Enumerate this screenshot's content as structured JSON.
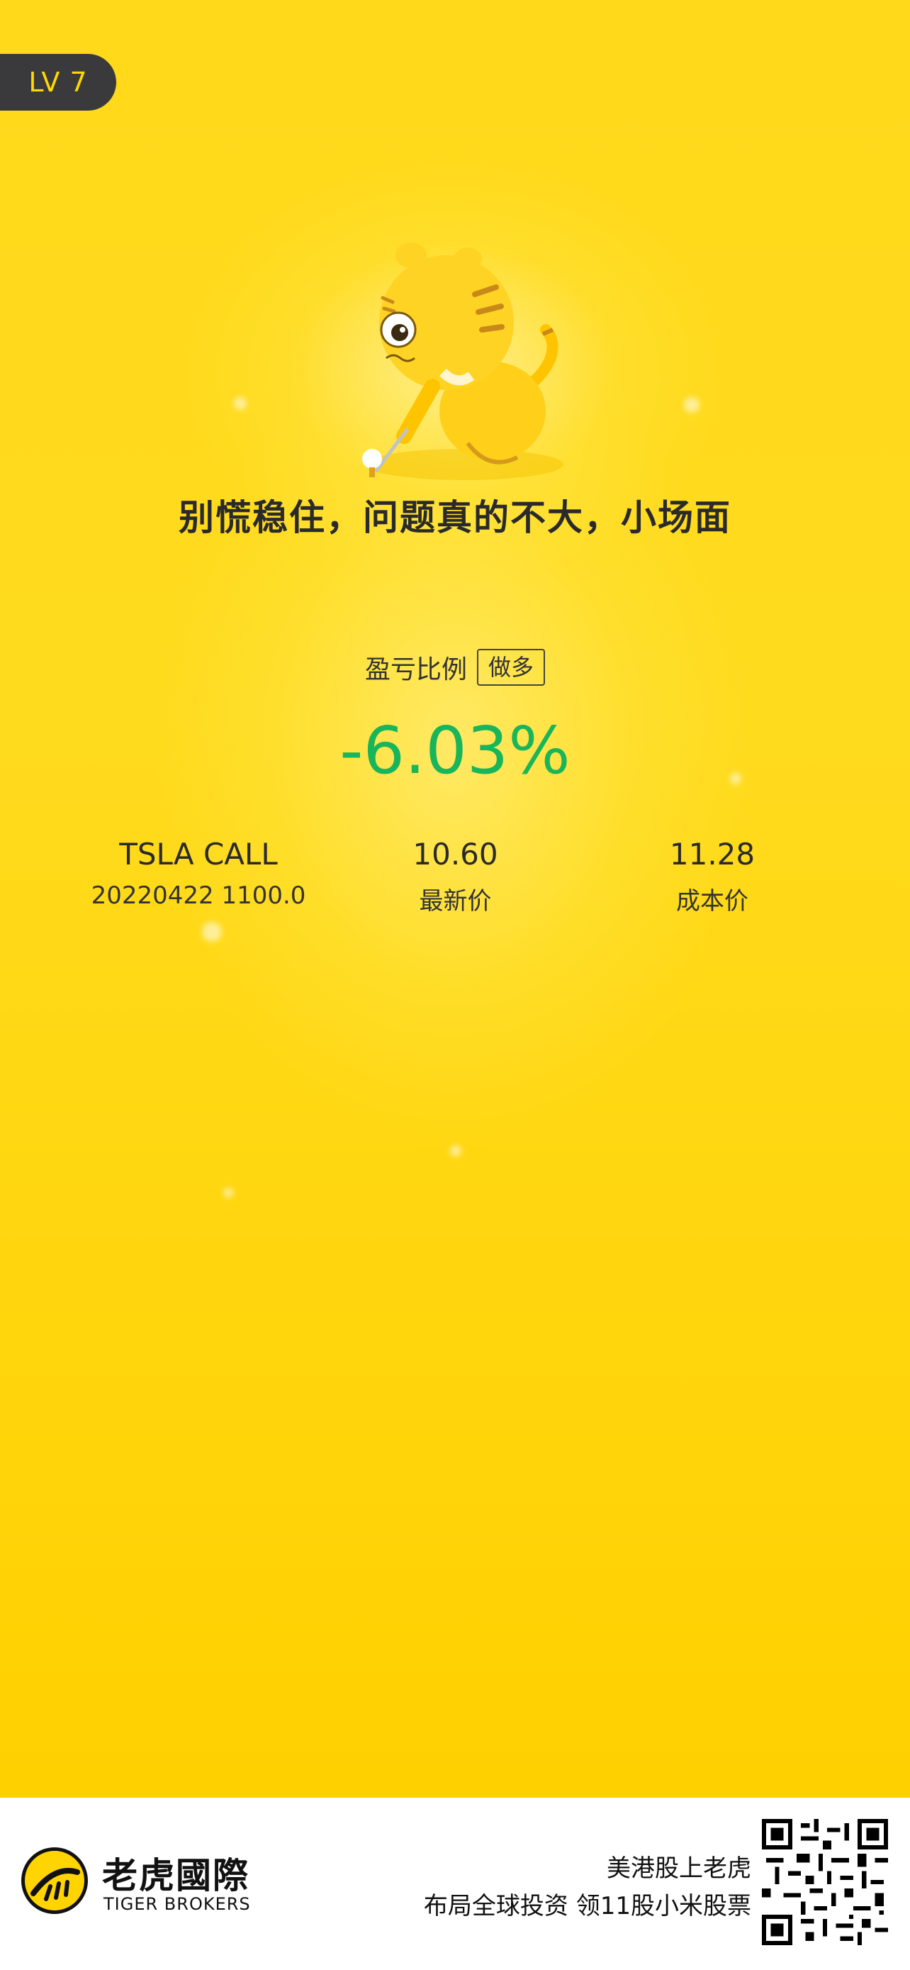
{
  "level_badge": "LV 7",
  "slogan": "别慌稳住，问题真的不大，小场面",
  "pl": {
    "label": "盈亏比例",
    "direction_tag": "做多",
    "value": "-6.03%",
    "value_color": "#19B55B"
  },
  "contract": {
    "name": "TSLA CALL",
    "detail": "20220422  1100.0"
  },
  "latest_price": {
    "value": "10.60",
    "label": "最新价"
  },
  "cost_price": {
    "value": "11.28",
    "label": "成本价"
  },
  "footer": {
    "brand_cn": "老虎國際",
    "brand_en": "TIGER BROKERS",
    "promo_line1": "美港股上老虎",
    "promo_line2": "布局全球投资 领11股小米股票",
    "qr_icon": "qr-code-icon"
  },
  "colors": {
    "background": "#FFD91A",
    "badge_bg": "#3A3A3C",
    "badge_text": "#FFD800"
  }
}
